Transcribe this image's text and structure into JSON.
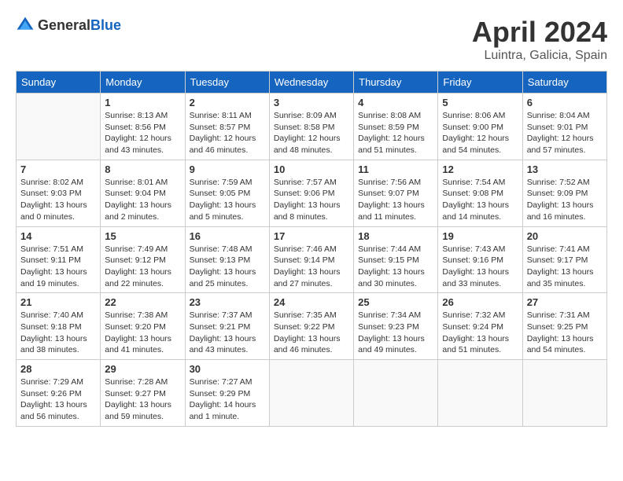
{
  "logo": {
    "text_general": "General",
    "text_blue": "Blue"
  },
  "header": {
    "title": "April 2024",
    "subtitle": "Luintra, Galicia, Spain"
  },
  "weekdays": [
    "Sunday",
    "Monday",
    "Tuesday",
    "Wednesday",
    "Thursday",
    "Friday",
    "Saturday"
  ],
  "weeks": [
    [
      {
        "day": "",
        "info": ""
      },
      {
        "day": "1",
        "info": "Sunrise: 8:13 AM\nSunset: 8:56 PM\nDaylight: 12 hours\nand 43 minutes."
      },
      {
        "day": "2",
        "info": "Sunrise: 8:11 AM\nSunset: 8:57 PM\nDaylight: 12 hours\nand 46 minutes."
      },
      {
        "day": "3",
        "info": "Sunrise: 8:09 AM\nSunset: 8:58 PM\nDaylight: 12 hours\nand 48 minutes."
      },
      {
        "day": "4",
        "info": "Sunrise: 8:08 AM\nSunset: 8:59 PM\nDaylight: 12 hours\nand 51 minutes."
      },
      {
        "day": "5",
        "info": "Sunrise: 8:06 AM\nSunset: 9:00 PM\nDaylight: 12 hours\nand 54 minutes."
      },
      {
        "day": "6",
        "info": "Sunrise: 8:04 AM\nSunset: 9:01 PM\nDaylight: 12 hours\nand 57 minutes."
      }
    ],
    [
      {
        "day": "7",
        "info": "Sunrise: 8:02 AM\nSunset: 9:03 PM\nDaylight: 13 hours\nand 0 minutes."
      },
      {
        "day": "8",
        "info": "Sunrise: 8:01 AM\nSunset: 9:04 PM\nDaylight: 13 hours\nand 2 minutes."
      },
      {
        "day": "9",
        "info": "Sunrise: 7:59 AM\nSunset: 9:05 PM\nDaylight: 13 hours\nand 5 minutes."
      },
      {
        "day": "10",
        "info": "Sunrise: 7:57 AM\nSunset: 9:06 PM\nDaylight: 13 hours\nand 8 minutes."
      },
      {
        "day": "11",
        "info": "Sunrise: 7:56 AM\nSunset: 9:07 PM\nDaylight: 13 hours\nand 11 minutes."
      },
      {
        "day": "12",
        "info": "Sunrise: 7:54 AM\nSunset: 9:08 PM\nDaylight: 13 hours\nand 14 minutes."
      },
      {
        "day": "13",
        "info": "Sunrise: 7:52 AM\nSunset: 9:09 PM\nDaylight: 13 hours\nand 16 minutes."
      }
    ],
    [
      {
        "day": "14",
        "info": "Sunrise: 7:51 AM\nSunset: 9:11 PM\nDaylight: 13 hours\nand 19 minutes."
      },
      {
        "day": "15",
        "info": "Sunrise: 7:49 AM\nSunset: 9:12 PM\nDaylight: 13 hours\nand 22 minutes."
      },
      {
        "day": "16",
        "info": "Sunrise: 7:48 AM\nSunset: 9:13 PM\nDaylight: 13 hours\nand 25 minutes."
      },
      {
        "day": "17",
        "info": "Sunrise: 7:46 AM\nSunset: 9:14 PM\nDaylight: 13 hours\nand 27 minutes."
      },
      {
        "day": "18",
        "info": "Sunrise: 7:44 AM\nSunset: 9:15 PM\nDaylight: 13 hours\nand 30 minutes."
      },
      {
        "day": "19",
        "info": "Sunrise: 7:43 AM\nSunset: 9:16 PM\nDaylight: 13 hours\nand 33 minutes."
      },
      {
        "day": "20",
        "info": "Sunrise: 7:41 AM\nSunset: 9:17 PM\nDaylight: 13 hours\nand 35 minutes."
      }
    ],
    [
      {
        "day": "21",
        "info": "Sunrise: 7:40 AM\nSunset: 9:18 PM\nDaylight: 13 hours\nand 38 minutes."
      },
      {
        "day": "22",
        "info": "Sunrise: 7:38 AM\nSunset: 9:20 PM\nDaylight: 13 hours\nand 41 minutes."
      },
      {
        "day": "23",
        "info": "Sunrise: 7:37 AM\nSunset: 9:21 PM\nDaylight: 13 hours\nand 43 minutes."
      },
      {
        "day": "24",
        "info": "Sunrise: 7:35 AM\nSunset: 9:22 PM\nDaylight: 13 hours\nand 46 minutes."
      },
      {
        "day": "25",
        "info": "Sunrise: 7:34 AM\nSunset: 9:23 PM\nDaylight: 13 hours\nand 49 minutes."
      },
      {
        "day": "26",
        "info": "Sunrise: 7:32 AM\nSunset: 9:24 PM\nDaylight: 13 hours\nand 51 minutes."
      },
      {
        "day": "27",
        "info": "Sunrise: 7:31 AM\nSunset: 9:25 PM\nDaylight: 13 hours\nand 54 minutes."
      }
    ],
    [
      {
        "day": "28",
        "info": "Sunrise: 7:29 AM\nSunset: 9:26 PM\nDaylight: 13 hours\nand 56 minutes."
      },
      {
        "day": "29",
        "info": "Sunrise: 7:28 AM\nSunset: 9:27 PM\nDaylight: 13 hours\nand 59 minutes."
      },
      {
        "day": "30",
        "info": "Sunrise: 7:27 AM\nSunset: 9:29 PM\nDaylight: 14 hours\nand 1 minute."
      },
      {
        "day": "",
        "info": ""
      },
      {
        "day": "",
        "info": ""
      },
      {
        "day": "",
        "info": ""
      },
      {
        "day": "",
        "info": ""
      }
    ]
  ]
}
